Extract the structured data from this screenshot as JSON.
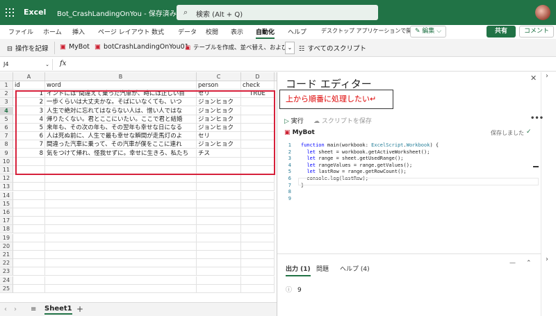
{
  "titlebar": {
    "app_name": "Excel",
    "doc_title": "Bot_CrashLandingOnYou - 保存済み ⌵",
    "search_placeholder": "検索 (Alt + Q)"
  },
  "ribbon": {
    "tabs": [
      "ファイル",
      "ホーム",
      "挿入",
      "ページ レイアウト",
      "数式",
      "データ",
      "校閲",
      "表示",
      "自動化",
      "ヘルプ"
    ],
    "active_tab": "自動化",
    "desktop_open": "デスクトップ アプリケーションで開く",
    "edit_label": "✎ 編集 ⌵",
    "share_label": "共有",
    "comment_label": "コメント"
  },
  "toolbar": {
    "record": "操作を記録",
    "scripts": [
      "MyBot",
      "botCrashLandingOnYou01",
      "テーブルを作成、並べ替え、および..."
    ],
    "all_scripts": "すべてのスクリプト"
  },
  "formula_bar": {
    "name_box": "J4",
    "fx": "fx",
    "value": ""
  },
  "grid": {
    "columns": [
      "A",
      "B",
      "C",
      "D"
    ],
    "headers": {
      "id": "id",
      "word": "word",
      "person": "person",
      "check": "check"
    },
    "rows": [
      {
        "row": "2",
        "id": "1",
        "word": "インドには\"間違えて乗った汽車が、時には正しい目",
        "person": "セリ",
        "check": "TRUE"
      },
      {
        "row": "3",
        "id": "2",
        "word": "一歩くらいは大丈夫かな。そばにいなくても、いつ",
        "person": "ジョンヒョク",
        "check": ""
      },
      {
        "row": "4",
        "id": "3",
        "word": "人生で絶対に忘れてはならない人は、憎い人ではな",
        "person": "ジョンヒョク",
        "check": ""
      },
      {
        "row": "5",
        "id": "4",
        "word": "帰りたくない。君とここにいたい。ここで君と結婚",
        "person": "ジョンヒョク",
        "check": ""
      },
      {
        "row": "6",
        "id": "5",
        "word": "来年も、その次の年も、その翌年も幸せな日になる",
        "person": "ジョンヒョク",
        "check": ""
      },
      {
        "row": "7",
        "id": "6",
        "word": "人は死ぬ前に、人生で最も幸せな瞬間が走馬灯のよ",
        "person": "セリ",
        "check": ""
      },
      {
        "row": "8",
        "id": "7",
        "word": "間違った汽車に乗って、その汽車が僕をここに連れ",
        "person": "ジョンヒョク",
        "check": ""
      },
      {
        "row": "9",
        "id": "8",
        "word": "気をつけて帰れ、怪我せずに。幸せに生きろ、私たち",
        "person": "チス",
        "check": ""
      }
    ],
    "empty_rows": [
      "10",
      "11",
      "12",
      "13",
      "14",
      "15",
      "16",
      "17",
      "18",
      "19",
      "20",
      "21",
      "22",
      "23",
      "24",
      "25"
    ],
    "header_row": "1",
    "selected_row": "4"
  },
  "sheets": {
    "active": "Sheet1",
    "add": "+",
    "menu": "≡"
  },
  "editor": {
    "title": "コード エディター",
    "note": "上から順番に処理したい↵",
    "run": "実行",
    "save": "スクリプトを保存",
    "more": "•••",
    "script_name": "MyBot",
    "saved": "保存しました",
    "code_lines": [
      "function main(workbook: ExcelScript.Workbook) {",
      "  let sheet = workbook.getActiveWorksheet();",
      "  let range = sheet.getUsedRange();",
      "  let rangeValues = range.getValues();",
      "  let lastRow = range.getRowCount();",
      "  console.log(lastRow);",
      "}",
      "",
      ""
    ],
    "output_tabs": [
      "出力 (1)",
      "問題",
      "ヘルプ (4)"
    ],
    "output_value": "9"
  }
}
